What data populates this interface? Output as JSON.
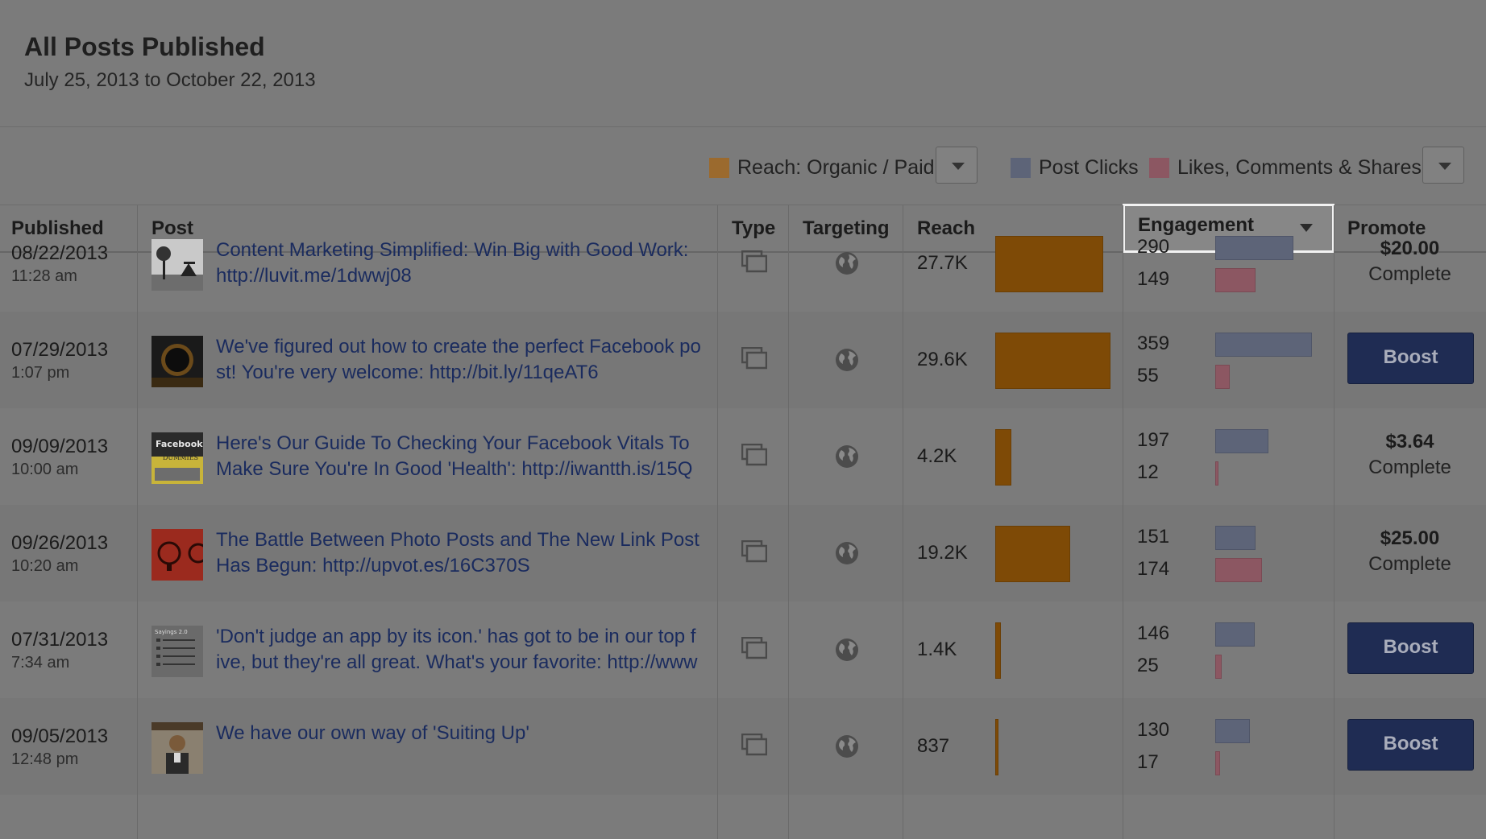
{
  "header": {
    "title": "All Posts Published",
    "date_range": "July 25, 2013 to October 22, 2013"
  },
  "legend": {
    "reach_label": "Reach: Organic / Paid",
    "post_clicks_label": "Post Clicks",
    "likes_label": "Likes, Comments & Shares",
    "reach_color": "#7e4a06",
    "post_clicks_color": "#5d6478",
    "likes_color": "#8c5762"
  },
  "columns": {
    "published": "Published",
    "post": "Post",
    "type": "Type",
    "targeting": "Targeting",
    "reach": "Reach",
    "engagement": "Engagement",
    "promote": "Promote"
  },
  "rows": [
    {
      "date": "08/22/2013",
      "time": "11:28 am",
      "text": "Content Marketing Simplified: Win Big with Good Work:\nhttp://luvit.me/1dwwj08",
      "reach": "27.7K",
      "reach_value": 27700,
      "clicks": "290",
      "likes": "149",
      "promote_amount": "$20.00",
      "promote_status": "Complete"
    },
    {
      "date": "07/29/2013",
      "time": "1:07 pm",
      "text": "We've figured out how to create the perfect Facebook po\nst! You're very welcome: http://bit.ly/11qeAT6",
      "reach": "29.6K",
      "reach_value": 29600,
      "clicks": "359",
      "likes": "55",
      "boost_label": "Boost"
    },
    {
      "date": "09/09/2013",
      "time": "10:00 am",
      "text": "Here's Our Guide To Checking Your Facebook Vitals To\nMake Sure You're In Good 'Health': http://iwantth.is/15Q",
      "reach": "4.2K",
      "reach_value": 4200,
      "clicks": "197",
      "likes": "12",
      "promote_amount": "$3.64",
      "promote_status": "Complete",
      "thumb_text": "Facebook DUMMIES"
    },
    {
      "date": "09/26/2013",
      "time": "10:20 am",
      "text": "The Battle Between Photo Posts and The New Link Post\nHas Begun: http://upvot.es/16C370S",
      "reach": "19.2K",
      "reach_value": 19200,
      "clicks": "151",
      "likes": "174",
      "promote_amount": "$25.00",
      "promote_status": "Complete"
    },
    {
      "date": "07/31/2013",
      "time": "7:34 am",
      "text": "'Don't judge an app by its icon.' has got to be in our top f\nive, but they're all great. What's your favorite: http://www",
      "reach": "1.4K",
      "reach_value": 1400,
      "clicks": "146",
      "likes": "25",
      "boost_label": "Boost",
      "thumb_text": "Sayings 2.0"
    },
    {
      "date": "09/05/2013",
      "time": "12:48 pm",
      "text": "We have our own way of 'Suiting Up'",
      "reach": "837",
      "reach_value": 837,
      "clicks": "130",
      "likes": "17",
      "boost_label": "Boost"
    }
  ]
}
